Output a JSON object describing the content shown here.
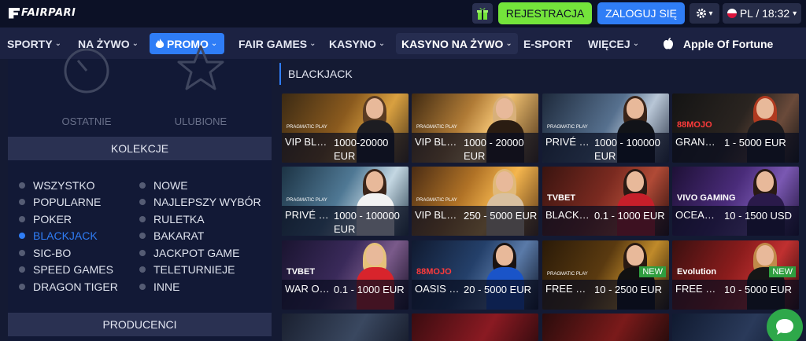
{
  "brand": {
    "name": "FAIRPARI"
  },
  "header": {
    "register": "REJESTRACJA",
    "login": "ZALOGUJ SIĘ",
    "lang_time": "PL / 18:32"
  },
  "nav": {
    "items": [
      "SPORTY",
      "NA ŻYWO",
      "PROMO",
      "FAIR GAMES",
      "KASYNO",
      "KASYNO NA ŻYWO",
      "E-SPORT",
      "WIĘCEJ"
    ],
    "apple_game": "Apple Of Fortune"
  },
  "sidebar": {
    "recent": "OSTATNIE",
    "favorites": "ULUBIONE",
    "collections_title": "KOLEKCJE",
    "collections_col1": [
      "WSZYSTKO",
      "POPULARNE",
      "POKER",
      "BLACKJACK",
      "SIC-BO",
      "SPEED GAMES",
      "DRAGON TIGER"
    ],
    "collections_col2": [
      "NOWE",
      "NAJLEPSZY WYBÓR",
      "RULETKA",
      "BAKARAT",
      "JACKPOT GAME",
      "TELETURNIEJE",
      "INNE"
    ],
    "active_collection": "BLACKJACK",
    "producers_title": "PRODUCENCI"
  },
  "main": {
    "section_title": "BLACKJACK",
    "tiles": [
      {
        "name": "VIP BLA…",
        "limit": "1000-20000 EUR",
        "provider": "PRAGMATIC PLAY",
        "badge": ""
      },
      {
        "name": "VIP BLA…",
        "limit": "1000 - 20000 EUR",
        "provider": "PRAGMATIC PLAY",
        "badge": ""
      },
      {
        "name": "PRIVÉ L…",
        "limit": "1000 - 100000 EUR",
        "provider": "PRAGMATIC PLAY",
        "badge": ""
      },
      {
        "name": "GRAND …",
        "limit": "1 - 5000 EUR",
        "provider": "88MOJO",
        "badge": ""
      },
      {
        "name": "PRIVÉ L…",
        "limit": "1000 - 100000 EUR",
        "provider": "PRAGMATIC PLAY",
        "badge": ""
      },
      {
        "name": "VIP BLA…",
        "limit": "250 - 5000 EUR",
        "provider": "PRAGMATIC PLAY",
        "badge": ""
      },
      {
        "name": "BLACKJ…",
        "limit": "0.1 - 1000 EUR",
        "provider": "TVBET",
        "badge": ""
      },
      {
        "name": "OCEANI…",
        "limit": "10 - 1500 USD",
        "provider": "VIVO GAMING",
        "badge": ""
      },
      {
        "name": "WAR OF …",
        "limit": "0.1 - 1000 EUR",
        "provider": "TVBET",
        "badge": ""
      },
      {
        "name": "OASIS B…",
        "limit": "20 - 5000 EUR",
        "provider": "88MOJO",
        "badge": ""
      },
      {
        "name": "FREE BE…",
        "limit": "10 - 2500 EUR",
        "provider": "PRAGMATIC PLAY",
        "badge": "NEW"
      },
      {
        "name": "FREE BE…",
        "limit": "10 - 5000 EUR",
        "provider": "Evolution",
        "badge": "NEW"
      }
    ]
  }
}
